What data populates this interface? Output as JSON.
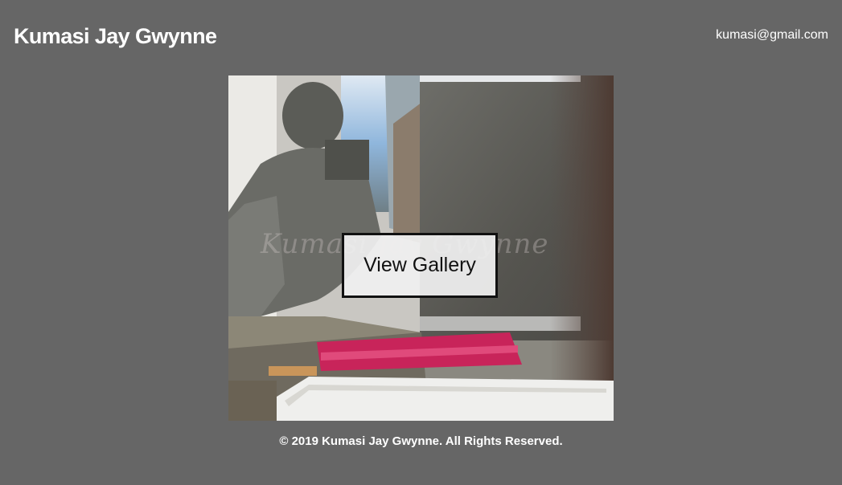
{
  "header": {
    "site_title": "Kumasi Jay Gwynne",
    "email": "kumasi@gmail.com"
  },
  "hero": {
    "image_description": "",
    "watermark_text": "Kumasi Jay Gwynne",
    "button_label": "View Gallery"
  },
  "footer": {
    "copyright": "© 2019 Kumasi Jay Gwynne. All Rights Reserved."
  },
  "colors": {
    "page_background": "#666666",
    "text": "#ffffff",
    "button_background": "#f0f0f0",
    "button_border": "#111111"
  }
}
